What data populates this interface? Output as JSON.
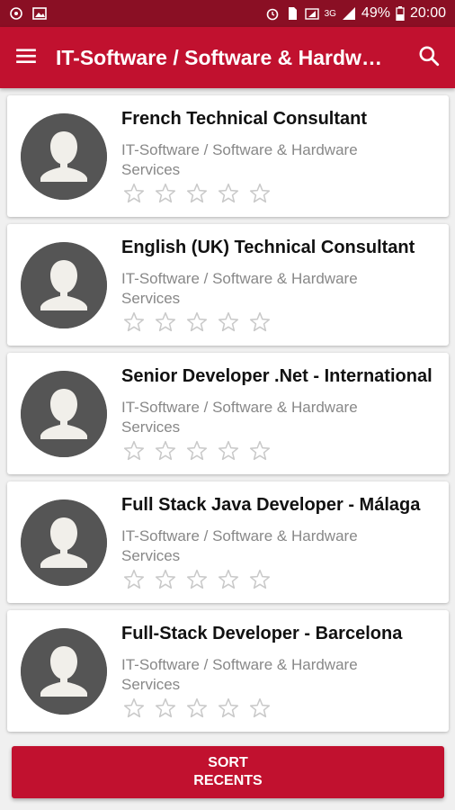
{
  "status_bar": {
    "battery": "49%",
    "time": "20:00",
    "network": "3G"
  },
  "app_bar": {
    "title": "IT-Software / Software & Hardware Services",
    "menu_icon": "hamburger-menu-icon",
    "search_icon": "search-icon"
  },
  "colors": {
    "primary": "#c1112f",
    "status_bar": "#8a0f24",
    "avatar_bg": "#555555"
  },
  "jobs": [
    {
      "title": "French Technical Consultant",
      "category": "IT-Software / Software & Hardware Services",
      "rating": 0
    },
    {
      "title": "English (UK) Technical Consultant",
      "category": "IT-Software / Software & Hardware Services",
      "rating": 0
    },
    {
      "title": "Senior Developer .Net - International",
      "category": "IT-Software / Software & Hardware Services",
      "rating": 0
    },
    {
      "title": "Full Stack Java Developer - Málaga",
      "category": "IT-Software / Software & Hardware Services",
      "rating": 0
    },
    {
      "title": "Full-Stack Developer - Barcelona",
      "category": "IT-Software / Software & Hardware Services",
      "rating": 0
    }
  ],
  "sort_button": {
    "line1": "SORT",
    "line2": "RECENTS"
  }
}
